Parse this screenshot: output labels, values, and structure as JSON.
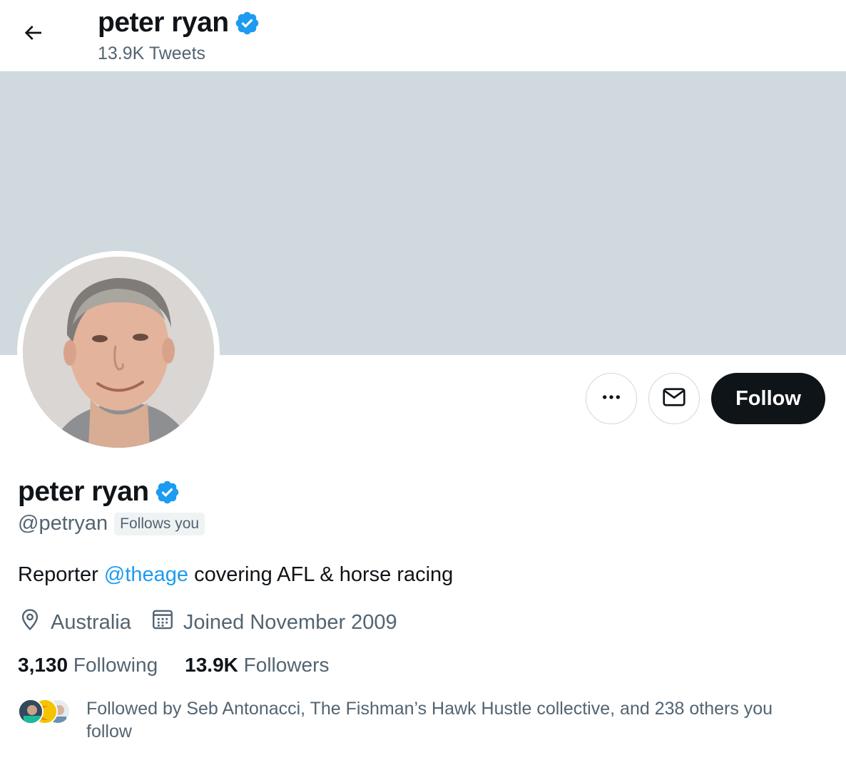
{
  "header": {
    "back_icon": "arrow-left-icon",
    "name": "peter ryan",
    "tweet_count": "13.9K Tweets"
  },
  "profile": {
    "name": "peter ryan",
    "handle": "@petryan",
    "follows_you": "Follows you",
    "bio_prefix": "Reporter ",
    "bio_mention": "@theage",
    "bio_suffix": " covering AFL & horse racing",
    "location": "Australia",
    "joined": "Joined November 2009"
  },
  "actions": {
    "more_icon": "ellipsis-icon",
    "message_icon": "envelope-icon",
    "follow_label": "Follow"
  },
  "stats": {
    "following_count": "3,130",
    "following_label": "Following",
    "followers_count": "13.9K",
    "followers_label": "Followers"
  },
  "followed_by": {
    "text": "Followed by Seb Antonacci, The Fishman’s Hawk Hustle collective, and 238 others you follow"
  },
  "colors": {
    "accent": "#1d9bf0",
    "banner": "#cfd9de",
    "text_primary": "#0f1419",
    "text_secondary": "#536471",
    "follow_button": "#0f1419"
  }
}
